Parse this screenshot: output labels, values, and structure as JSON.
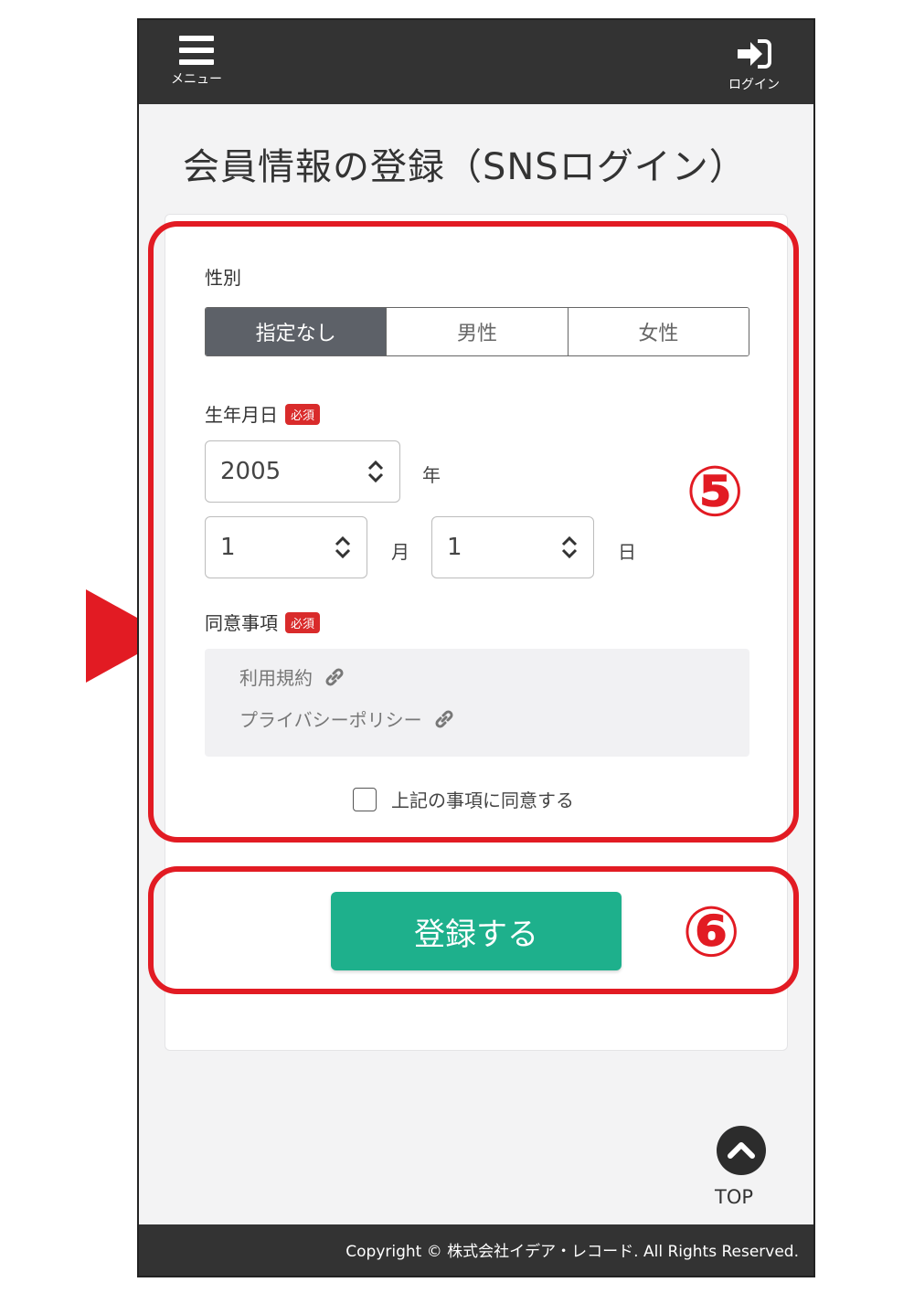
{
  "header": {
    "menu_label": "メニュー",
    "login_label": "ログイン"
  },
  "page_title": "会員情報の登録（SNSログイン）",
  "form": {
    "gender": {
      "label": "性別",
      "options": [
        "指定なし",
        "男性",
        "女性"
      ],
      "selected": "指定なし"
    },
    "birthdate": {
      "label": "生年月日",
      "required_badge": "必須",
      "year_value": "2005",
      "year_unit": "年",
      "month_value": "1",
      "month_unit": "月",
      "day_value": "1",
      "day_unit": "日"
    },
    "consent": {
      "label": "同意事項",
      "required_badge": "必須",
      "terms_link": "利用規約",
      "privacy_link": "プライバシーポリシー",
      "agree_label": "上記の事項に同意する"
    },
    "submit_label": "登録する"
  },
  "annotations": {
    "marker_5": "⑤",
    "marker_6": "⑥",
    "color": "#e21b23"
  },
  "top_button_label": "TOP",
  "footer": {
    "copyright": "Copyright © 株式会社イデア・レコード. All Rights Reserved."
  },
  "colors": {
    "header_bg": "#333333",
    "accent_green": "#1eb08c",
    "selected_segment": "#5d6168",
    "required_badge": "#d92b2b"
  }
}
